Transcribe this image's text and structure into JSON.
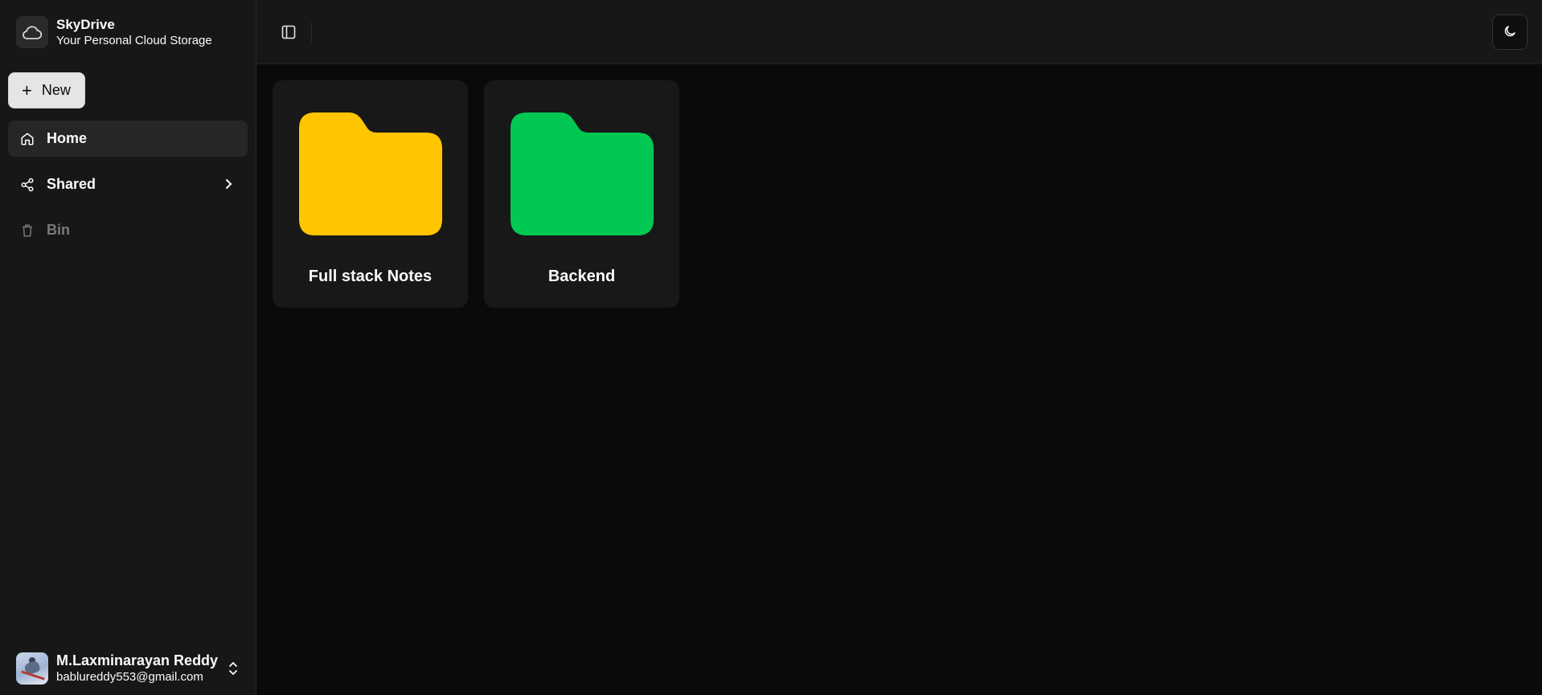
{
  "brand": {
    "name": "SkyDrive",
    "tagline": "Your Personal Cloud Storage"
  },
  "sidebar": {
    "new_label": "New",
    "items": [
      {
        "label": "Home",
        "icon": "home-icon",
        "active": true
      },
      {
        "label": "Shared",
        "icon": "share-icon",
        "has_submenu": true
      },
      {
        "label": "Bin",
        "icon": "trash-icon",
        "muted": true
      }
    ]
  },
  "user": {
    "name": "M.Laxminarayan Reddy",
    "email": "bablureddy553@gmail.com"
  },
  "folders": [
    {
      "name": "Full stack Notes",
      "color": "#FFC500"
    },
    {
      "name": "Backend",
      "color": "#00C853"
    }
  ],
  "colors": {
    "background": "#0a0a0a",
    "sidebar": "#171717",
    "accent": "#e5e5e5"
  }
}
